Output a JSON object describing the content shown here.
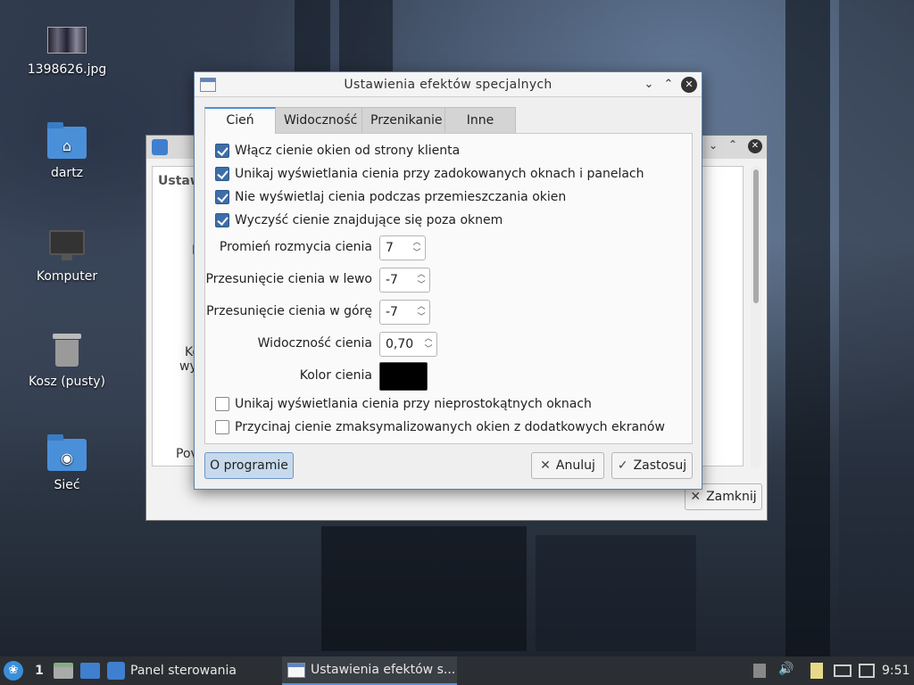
{
  "desktop": {
    "icons": [
      {
        "label": "1398626.jpg",
        "icon": "image-file-icon"
      },
      {
        "label": "dartz",
        "icon": "home-folder-icon"
      },
      {
        "label": "Komputer",
        "icon": "computer-icon"
      },
      {
        "label": "Kosz (pusty)",
        "icon": "trash-icon"
      },
      {
        "label": "Sieć",
        "icon": "network-folder-icon"
      }
    ]
  },
  "back_window": {
    "partial_labels": [
      "Ustaw",
      "D",
      "Ko",
      "wy",
      "Pov"
    ],
    "close_button": "Zamknij"
  },
  "dialog": {
    "title": "Ustawienia efektów specjalnych",
    "tabs": [
      {
        "label": "Cień",
        "active": true
      },
      {
        "label": "Widoczność",
        "active": false
      },
      {
        "label": "Przenikanie",
        "active": false
      },
      {
        "label": "Inne",
        "active": false
      }
    ],
    "checkboxes_top": [
      {
        "label": "Włącz cienie okien od strony klienta",
        "checked": true
      },
      {
        "label": "Unikaj wyświetlania cienia przy zadokowanych oknach i panelach",
        "checked": true
      },
      {
        "label": "Nie wyświetlaj cienia podczas przemieszczania okien",
        "checked": true
      },
      {
        "label": "Wyczyść cienie znajdujące się poza oknem",
        "checked": true
      }
    ],
    "fields": {
      "radius_label": "Promień rozmycia cienia",
      "radius_value": "7",
      "offset_left_label": "Przesunięcie cienia w lewo",
      "offset_left_value": "-7",
      "offset_up_label": "Przesunięcie cienia w górę",
      "offset_up_value": "-7",
      "opacity_label": "Widoczność cienia",
      "opacity_value": "0,70",
      "color_label": "Kolor cienia",
      "color_value": "#000000"
    },
    "checkboxes_bottom": [
      {
        "label": "Unikaj wyświetlania cienia przy nieprostokątnych oknach",
        "checked": false
      },
      {
        "label": "Przycinaj cienie zmaksymalizowanych okien z dodatkowych ekranów",
        "checked": false
      }
    ],
    "buttons": {
      "about": "O programie",
      "cancel": "Anuluj",
      "apply": "Zastosuj"
    }
  },
  "taskbar": {
    "workspace": "1",
    "tasks": [
      {
        "label": "Panel sterowania",
        "active": false
      },
      {
        "label": "Ustawienia efektów s...",
        "active": true
      }
    ],
    "clock": "9:51"
  },
  "colors": {
    "accent": "#4a90d9",
    "checkbox_on": "#3d6ea8",
    "taskbar": "#2b2f33"
  }
}
